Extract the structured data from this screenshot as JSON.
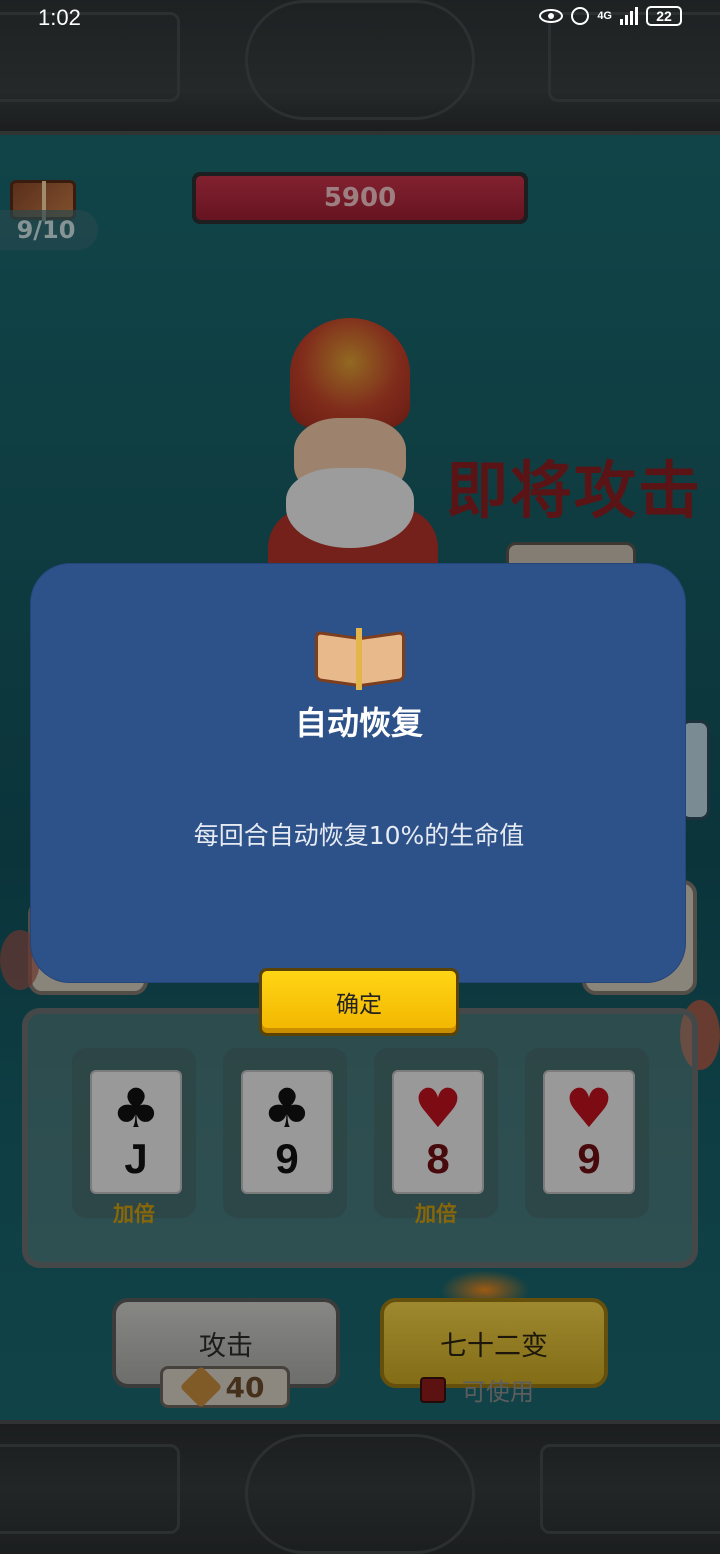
{
  "status_bar": {
    "time": "1:02",
    "network": "4G",
    "battery": "22"
  },
  "hud": {
    "book_count": "9/10",
    "boss_hp": "5900",
    "attack_warning": "即将攻击"
  },
  "hand": {
    "cards": [
      {
        "suit": "♣",
        "rank": "J",
        "color": "black",
        "label": "加倍"
      },
      {
        "suit": "♣",
        "rank": "9",
        "color": "black",
        "label": ""
      },
      {
        "suit": "♥",
        "rank": "8",
        "color": "red",
        "label": "加倍"
      },
      {
        "suit": "♥",
        "rank": "9",
        "color": "red",
        "label": ""
      }
    ]
  },
  "actions": {
    "attack_label": "攻击",
    "attack_cost": "40",
    "transform_label": "七十二变",
    "transform_status": "可使用"
  },
  "modal": {
    "title": "自动恢复",
    "description": "每回合自动恢复10%的生命值",
    "confirm_label": "确定"
  },
  "colors": {
    "modal_bg": "#2d5189",
    "confirm_bg": "#ffd515",
    "hp_bar": "#c8344a",
    "warning_text": "#8c1f21"
  },
  "icons": [
    "book-icon",
    "sword-icon",
    "fire-icon",
    "eye-icon",
    "alarm-icon",
    "signal-icon",
    "battery-icon"
  ]
}
